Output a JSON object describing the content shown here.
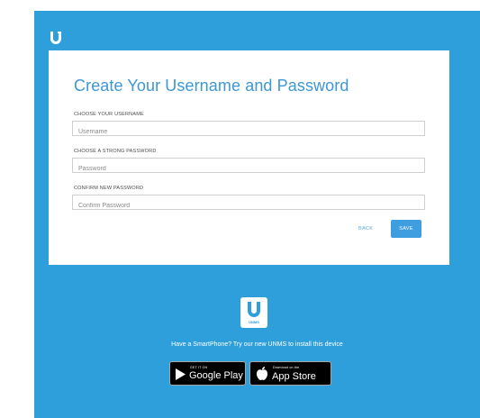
{
  "colors": {
    "panel_background": "#2f9fdb",
    "title": "#3d97d3",
    "save_button": "#3e9ee0"
  },
  "header": {
    "logo_icon": "ubiquiti-u-logo-icon"
  },
  "form": {
    "title": "Create Your Username and Password",
    "username_label": "CHOOSE YOUR USERNAME",
    "username_placeholder": "Username",
    "username_value": "",
    "password_label": "CHOOSE A STRONG PASSWORD",
    "password_placeholder": "Password",
    "password_value": "",
    "confirm_label": "CONFIRM NEW PASSWORD",
    "confirm_placeholder": "Confirm Password",
    "confirm_value": "",
    "back_label": "BACK",
    "save_label": "SAVE"
  },
  "promo": {
    "app_icon_text": "UNMS",
    "message": "Have a SmartPhone? Try our new UNMS to install this device",
    "google_play_small": "GET IT ON",
    "google_play_big": "Google Play",
    "app_store_small": "Download on the",
    "app_store_big": "App Store"
  }
}
